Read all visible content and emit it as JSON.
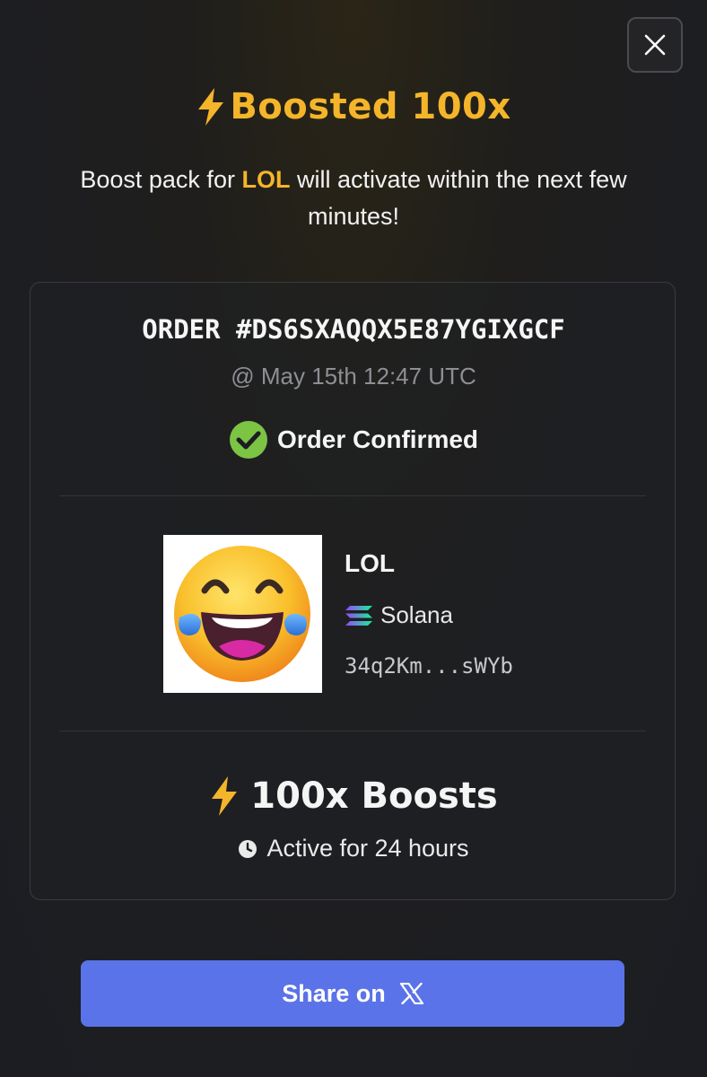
{
  "modal": {
    "close_icon": "close-icon",
    "title": "Boosted 100x",
    "subtitle": {
      "prefix": "Boost pack for ",
      "token": "LOL",
      "suffix": " will activate within the next few minutes!"
    },
    "accent_color": "#f4b52a"
  },
  "order": {
    "id": "ORDER #DS6SXAQQX5E87YGIXGCF",
    "time": "@ May 15th 12:47 UTC",
    "status": "Order Confirmed",
    "status_color": "#7cc444"
  },
  "token": {
    "name": "LOL",
    "chain": "Solana",
    "address": "34q2Km...sWYb",
    "image_icon": "laughing-face-emoji"
  },
  "boost": {
    "label": "100x Boosts",
    "duration": "Active for 24 hours"
  },
  "share": {
    "label": "Share on",
    "icon": "x-logo-icon",
    "color": "#5a73e8"
  }
}
